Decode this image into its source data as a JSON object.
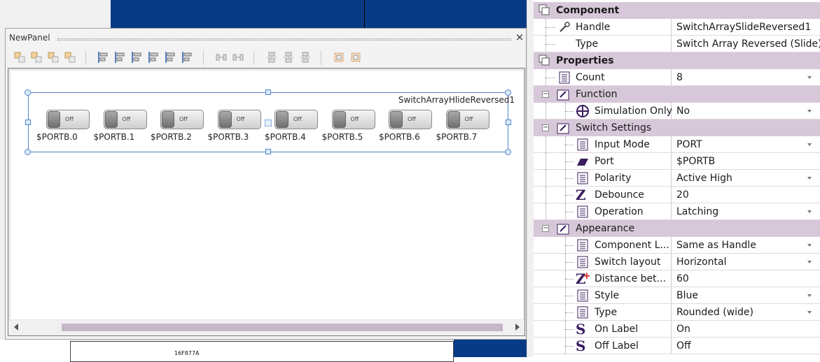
{
  "panel": {
    "title": "NewPanel",
    "close_glyph": "×",
    "toolbar": [
      "align-group-icon",
      "align-group2-icon",
      "align-group3-icon",
      "align-group4-icon",
      "align-left-icon",
      "align-center-icon",
      "align-right-icon",
      "align-top-icon",
      "align-middle-icon",
      "align-bottom-icon",
      "distribute-h-icon",
      "distribute-v-icon",
      "space-h-icon",
      "space-v-icon",
      "space-center-icon",
      "group-icon",
      "ungroup-icon"
    ]
  },
  "component": {
    "name": "SwitchArrayHlideReversed1",
    "switch_state_text": "Off",
    "switches": [
      "$PORTB.0",
      "$PORTB.1",
      "$PORTB.2",
      "$PORTB.3",
      "$PORTB.4",
      "$PORTB.5",
      "$PORTB.6",
      "$PORTB.7"
    ]
  },
  "workspace": {
    "chip_label": "16F877A"
  },
  "properties": {
    "cat_component": "Component",
    "handle_label": "Handle",
    "handle_value": "SwitchArraySlideReversed1",
    "type_label": "Type",
    "type_value": "Switch Array Reversed (Slide)",
    "cat_properties": "Properties",
    "count_label": "Count",
    "count_value": "8",
    "grp_function": "Function",
    "sim_label": "Simulation Only",
    "sim_value": "No",
    "grp_switch": "Switch Settings",
    "input_mode_label": "Input Mode",
    "input_mode_value": "PORT",
    "port_label": "Port",
    "port_value": "$PORTB",
    "polarity_label": "Polarity",
    "polarity_value": "Active High",
    "debounce_label": "Debounce",
    "debounce_value": "20",
    "operation_label": "Operation",
    "operation_value": "Latching",
    "grp_appearance": "Appearance",
    "comp_label_label": "Component L...",
    "comp_label_value": "Same as Handle",
    "switch_layout_label": "Switch layout",
    "switch_layout_value": "Horizontal",
    "distance_label": "Distance bet...",
    "distance_value": "60",
    "style_label": "Style",
    "style_value": "Blue",
    "type2_label": "Type",
    "type2_value": "Rounded (wide)",
    "on_label_label": "On Label",
    "on_label_value": "On",
    "off_label_label": "Off Label",
    "off_label_value": "Off"
  },
  "colors": {
    "category_bg": "#d7c8d9",
    "workspace_blue": "#083a86",
    "selection_blue": "#4f86c6",
    "scroll_thumb": "#c7b6c9"
  }
}
